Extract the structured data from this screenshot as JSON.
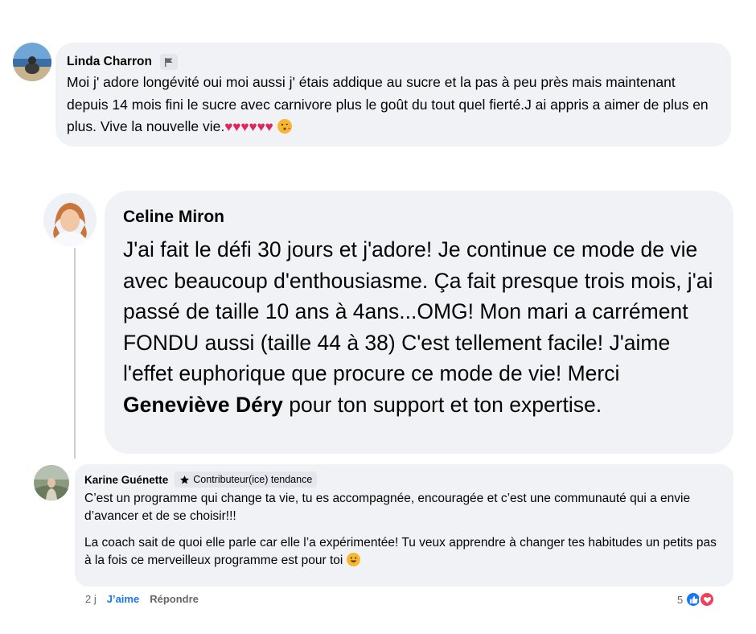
{
  "comments": [
    {
      "author": "Linda Charron",
      "badge_icon": "flag-icon",
      "text": "Moi j' adore longévité oui moi aussi j' étais addique au sucre et la pas à peu près mais maintenant depuis 14 mois fini le sucre avec carnivore plus le goût du tout quel fierté.J ai appris a aimer de plus en plus. Vive la nouvelle vie.",
      "trailing_emojis": [
        "two-hearts-icon",
        "two-hearts-icon",
        "two-hearts-icon",
        "face-blowing-kiss-icon"
      ]
    },
    {
      "author": "Celine Miron",
      "text_before": "J'ai fait le défi 30 jours et j'adore! Je continue ce mode de vie avec beaucoup d'enthousiasme. Ça fait presque trois mois, j'ai passé de taille 10 ans à 4ans...OMG! Mon mari a carrément FONDU aussi (taille 44 à 38) C'est tellement facile! J'aime l'effet euphorique que procure ce mode de vie! Merci ",
      "mention": "Geneviève Déry",
      "text_after": " pour ton support et ton expertise."
    },
    {
      "author": "Karine Guénette",
      "badge_label": "Contributeur(ice) tendance",
      "badge_icon": "star-icon",
      "paragraph1": "C’est un programme qui change ta vie, tu es accompagnée, encouragée et c’est une communauté qui a envie d’avancer et de se choisir!!!",
      "paragraph2": "La coach sait de quoi elle parle car elle l’a expérimentée! Tu veux apprendre à changer tes habitudes un petits pas à la fois ce merveilleux programme est pour toi",
      "trailing_emoji": "grinning-face-icon",
      "time": "2 j",
      "like_label": "J’aime",
      "reply_label": "Répondre",
      "reaction_count": "5",
      "reaction_icons": [
        "like-reaction-icon",
        "love-reaction-icon"
      ],
      "colors": {
        "like_blue": "#1877f2",
        "love_red": "#f33e58"
      }
    }
  ]
}
